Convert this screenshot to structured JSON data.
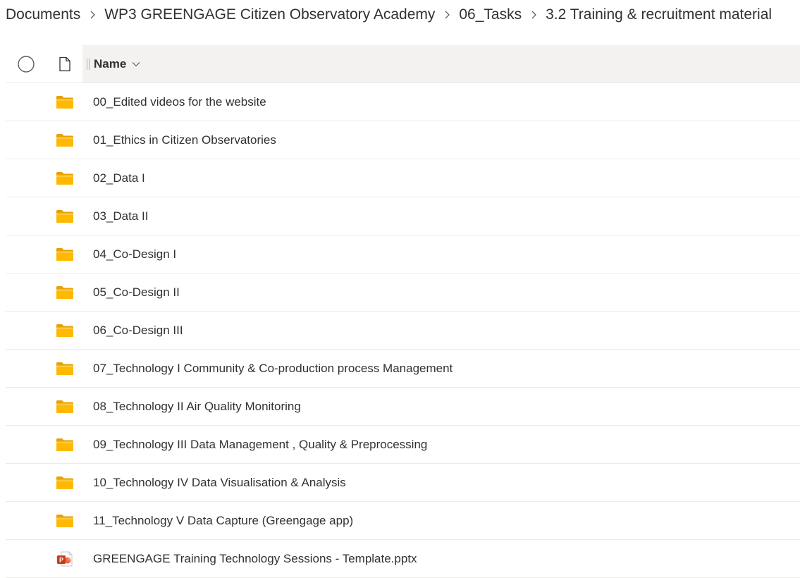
{
  "breadcrumb": {
    "items": [
      "Documents",
      "WP3 GREENGAGE Citizen Observatory Academy",
      "06_Tasks",
      "3.2 Training & recruitment material"
    ]
  },
  "list": {
    "header": {
      "name_label": "Name"
    },
    "rows": [
      {
        "name": "00_Edited videos for the website",
        "icon": "folder-icon"
      },
      {
        "name": "01_Ethics in Citizen Observatories",
        "icon": "folder-icon"
      },
      {
        "name": "02_Data I",
        "icon": "folder-icon"
      },
      {
        "name": "03_Data II",
        "icon": "folder-icon"
      },
      {
        "name": "04_Co-Design I",
        "icon": "folder-icon"
      },
      {
        "name": "05_Co-Design II",
        "icon": "folder-icon"
      },
      {
        "name": "06_Co-Design III",
        "icon": "folder-icon"
      },
      {
        "name": "07_Technology I Community & Co-production process Management",
        "icon": "folder-icon"
      },
      {
        "name": "08_Technology II Air Quality Monitoring",
        "icon": "folder-icon"
      },
      {
        "name": "09_Technology III Data Management , Quality & Preprocessing",
        "icon": "folder-icon"
      },
      {
        "name": "10_Technology IV Data Visualisation & Analysis",
        "icon": "folder-icon"
      },
      {
        "name": "11_Technology V Data Capture (Greengage app)",
        "icon": "folder-icon"
      },
      {
        "name": "GREENGAGE Training Technology Sessions - Template.pptx",
        "icon": "powerpoint-file-icon"
      }
    ]
  },
  "colors": {
    "folder": "#FFB900",
    "folder_back": "#E8A200",
    "powerpoint": "#C43E1C",
    "header_bg": "#F3F2F1",
    "divider": "#EDEBE9"
  }
}
